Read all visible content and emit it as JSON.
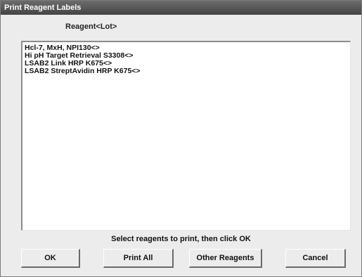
{
  "window": {
    "title": "Print Reagent Labels"
  },
  "list": {
    "header": "Reagent<Lot>",
    "items": [
      "Hcl-7, MxH, NPI130<>",
      "Hi pH Target Retrieval S3308<>",
      "LSAB2 Link HRP K675<>",
      "LSAB2 StreptAvidin HRP K675<>"
    ]
  },
  "instruction": "Select reagents to print, then click OK",
  "buttons": {
    "ok": "OK",
    "print_all": "Print All",
    "other_reagents": "Other Reagents",
    "cancel": "Cancel"
  },
  "colors": {
    "titlebar": "#555555",
    "dialog_background": "#ececec",
    "list_background": "#ffffff"
  }
}
